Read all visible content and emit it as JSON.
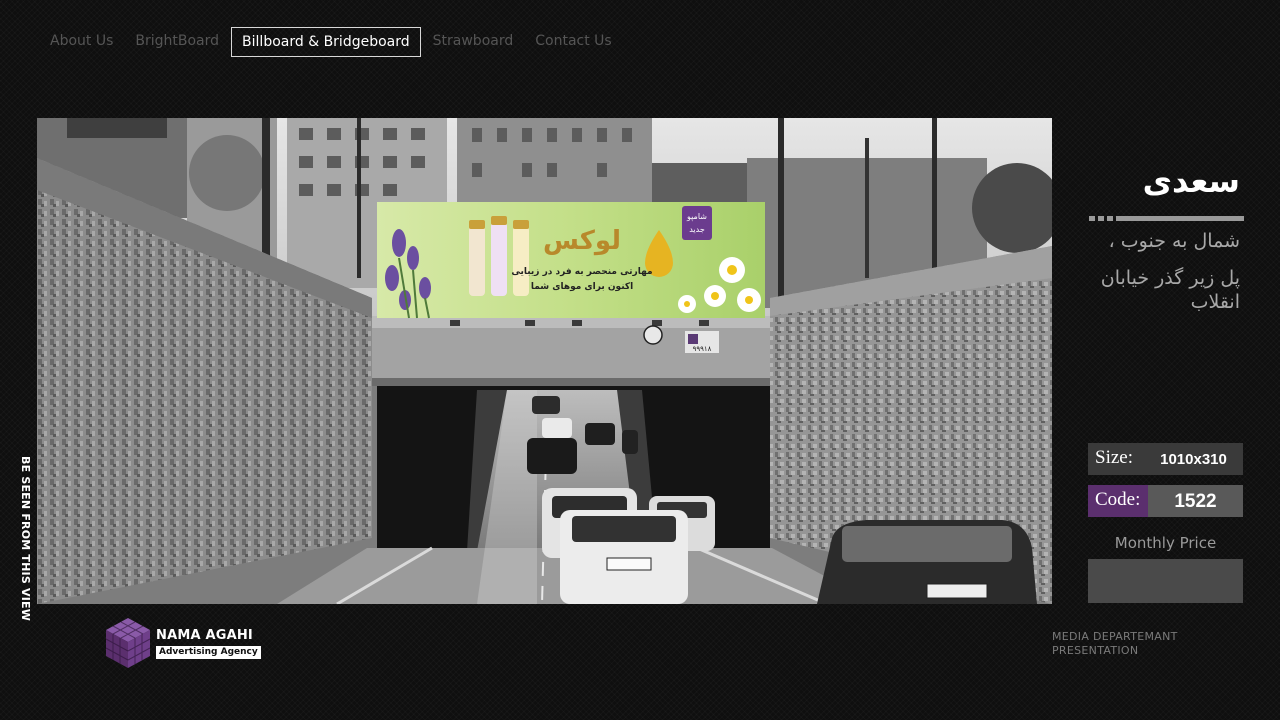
{
  "nav": {
    "items": [
      {
        "label": "About Us",
        "active": false
      },
      {
        "label": "BrightBoard",
        "active": false
      },
      {
        "label": "Billboard & Bridgeboard",
        "active": true
      },
      {
        "label": "Strawboard",
        "active": false
      },
      {
        "label": "Contact Us",
        "active": false
      }
    ]
  },
  "photo": {
    "ad": {
      "brand": "لوکس",
      "line1": "مهارتی منحصر به فرد در زیبایی",
      "line2": "اکنون برای موهای شما",
      "badge": "شامپو جدید",
      "colors": {
        "green": "#b9d77a",
        "purple": "#6b3c8e",
        "gold": "#c9a03a"
      }
    },
    "sign_number": "۹۹۹۱۸"
  },
  "side_label": "BE SEEN FROM THIS VIEW",
  "details": {
    "title": "سعدی",
    "direction": "شمال به جنوب ،",
    "location": "پل زیر گذر خیابان انقلاب",
    "size_label": "Size:",
    "size_value": "1010x310",
    "code_label": "Code:",
    "code_value": "1522",
    "price_label": "Monthly Price",
    "price_value": ""
  },
  "footer": {
    "logo_name": "NAMA AGAHI",
    "logo_tag": "Advertising Agency",
    "right_line1": "MEDIA DEPARTEMANT",
    "right_line2": "PRESENTATION"
  },
  "colors": {
    "accent": "#5b2f6e",
    "panel": "#595959"
  }
}
